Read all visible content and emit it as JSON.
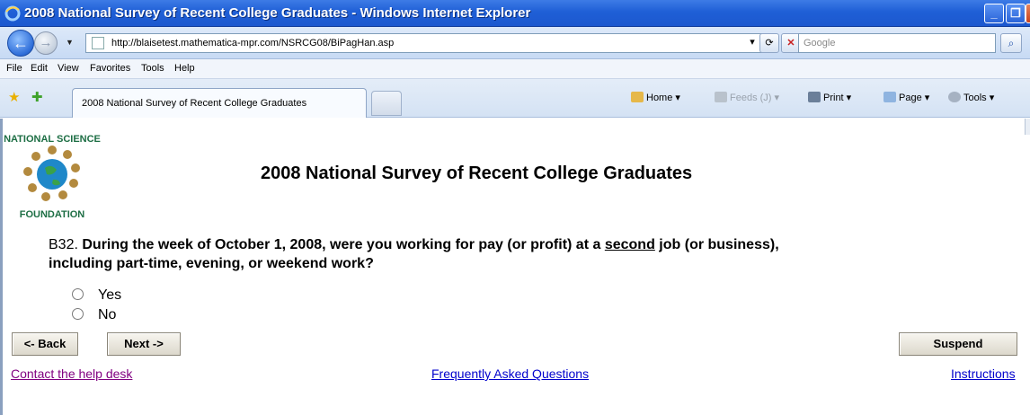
{
  "window": {
    "title": "2008 National Survey of Recent College Graduates - Windows Internet Explorer",
    "min": "_",
    "max": "❐",
    "close": "X"
  },
  "address_bar": {
    "url": "http://blaisetest.mathematica-mpr.com/NSRCG08/BiPagHan.asp",
    "search_placeholder": "Google"
  },
  "menu": [
    "File",
    "Edit",
    "View",
    "Favorites",
    "Tools",
    "Help"
  ],
  "tab": {
    "label": "2008 National Survey of Recent College Graduates"
  },
  "command_bar": {
    "home": "Home",
    "feeds": "Feeds (J)",
    "print": "Print",
    "page": "Page",
    "tools": "Tools"
  },
  "logo": {
    "text_top": "NATIONAL SCIENCE",
    "text_bottom": "FOUNDATION"
  },
  "page": {
    "title": "2008 National Survey of Recent College Graduates",
    "question_number": "B32.",
    "question_part1": "During the week of October 1, 2008, were you working for pay (or profit) at a",
    "question_underlined": "second",
    "question_part2": "job (or business), including part-time, evening, or weekend work?",
    "options": [
      "Yes",
      "No"
    ],
    "back_label": "<- Back",
    "next_label": "Next ->",
    "suspend_label": "Suspend",
    "links": {
      "help_desk": "Contact the help desk",
      "faq": "Frequently Asked Questions",
      "instructions": "Instructions"
    }
  }
}
